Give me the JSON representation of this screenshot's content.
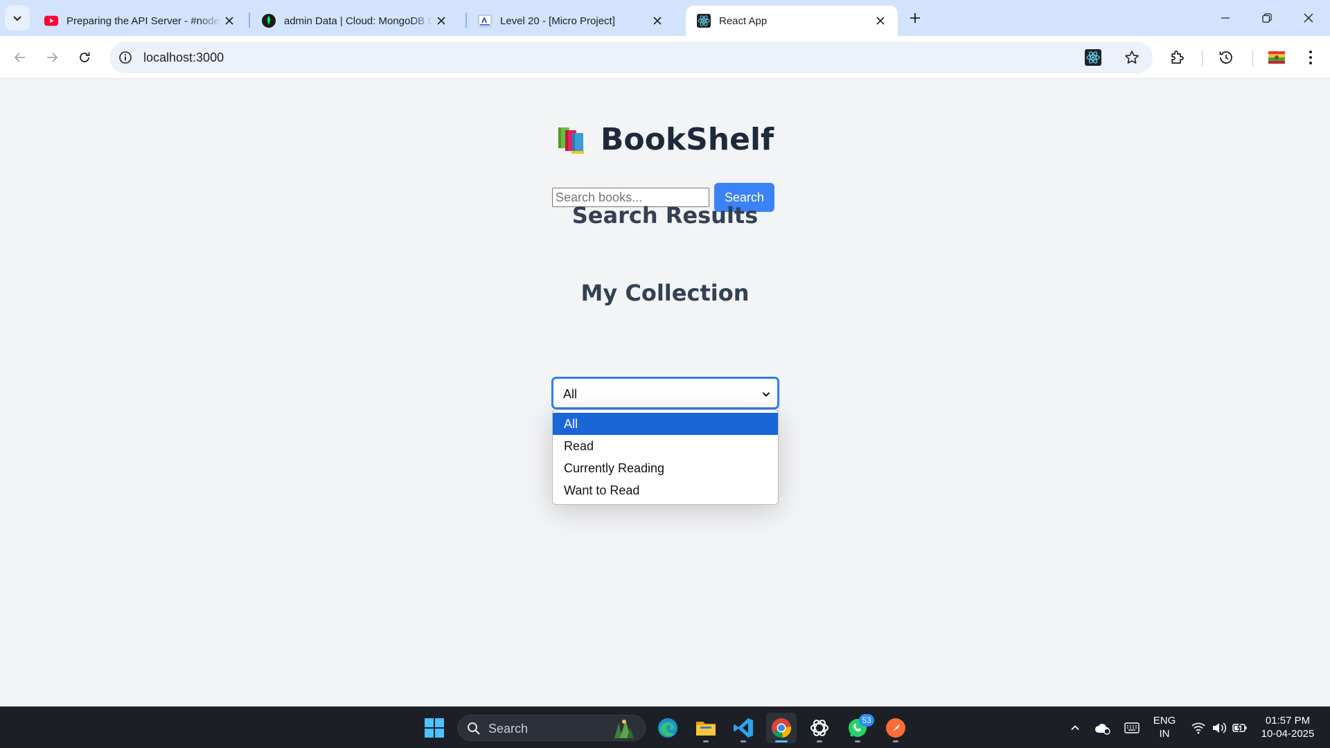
{
  "browser": {
    "tabs": [
      {
        "title": "Preparing the API Server - #nodejs",
        "favicon": "youtube-icon",
        "active": false
      },
      {
        "title": "admin Data | Cloud: MongoDB Cloud",
        "favicon": "mongodb-icon",
        "active": false
      },
      {
        "title": "Level 20 - [Micro Project]",
        "favicon": "course-icon",
        "active": false
      },
      {
        "title": "React App",
        "favicon": "react-icon",
        "active": true
      }
    ],
    "url": "localhost:3000"
  },
  "app": {
    "title": "BookShelf",
    "search": {
      "placeholder": "Search books...",
      "value": "",
      "button_label": "Search"
    },
    "search_results_heading": "Search Results",
    "collection_heading": "My Collection",
    "filter": {
      "selected": "All",
      "options": [
        "All",
        "Read",
        "Currently Reading",
        "Want to Read"
      ]
    }
  },
  "taskbar": {
    "search_label": "Search",
    "whatsapp_badge": "53",
    "language": "ENG",
    "region": "IN",
    "time": "01:57 PM",
    "date": "10-04-2025"
  },
  "colors": {
    "accent": "#3b82f6",
    "tabstrip": "#d3e3fd",
    "page_bg": "#f3f4f6",
    "selected_option": "#1a66d9"
  }
}
